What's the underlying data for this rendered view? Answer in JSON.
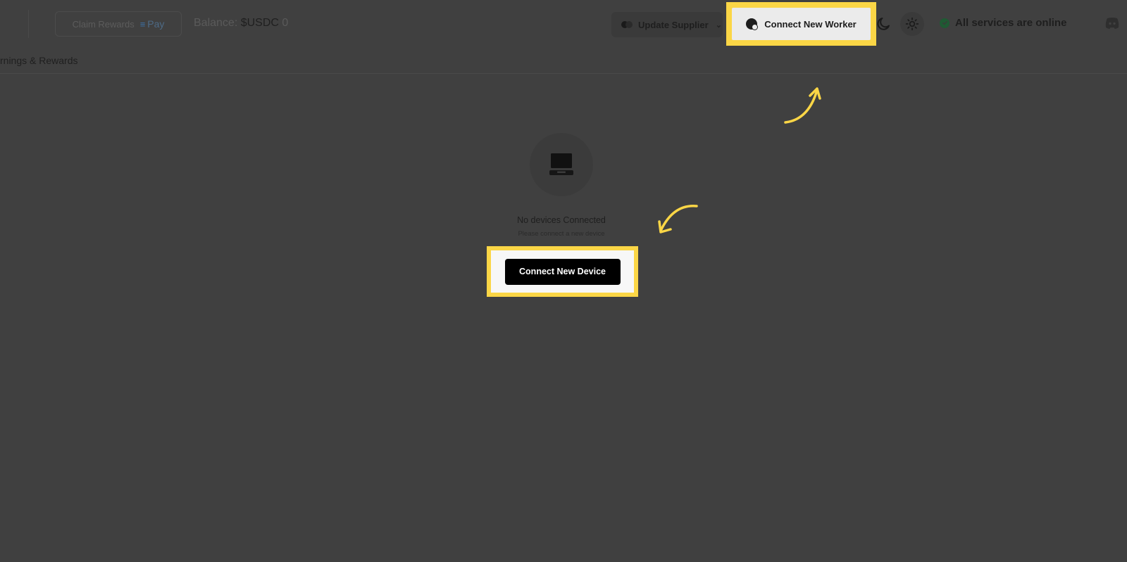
{
  "header": {
    "claim_rewards_label": "Claim Rewards",
    "pay_label": "Pay",
    "balance_label": "Balance:",
    "balance_currency": "$USDC",
    "balance_value": "0",
    "update_supplier_label": "Update Supplier",
    "connect_worker_label": "Connect New Worker",
    "status_text": "All services are online"
  },
  "tabs": {
    "earnings_label": "rnings & Rewards"
  },
  "empty_state": {
    "title": "No devices Connected",
    "subtitle": "Please connect a new device",
    "button_label": "Connect New Device"
  },
  "icons": {
    "worker": "worker-icon",
    "moon": "moon-icon",
    "sun": "sun-icon",
    "status": "check-icon",
    "discord": "discord-icon",
    "device": "computer-icon",
    "supplier": "toggle-icon"
  },
  "colors": {
    "highlight": "#fbd646",
    "overlay": "#404040",
    "button_dark": "#000000",
    "status_ok": "#1f5a33"
  }
}
